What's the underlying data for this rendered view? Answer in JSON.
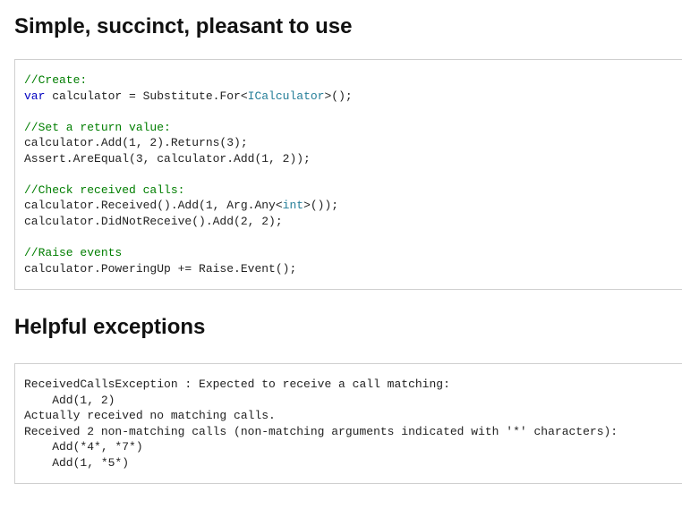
{
  "section1": {
    "heading": "Simple, succinct, pleasant to use",
    "code": {
      "c1": "//Create:",
      "kw_var": "var",
      "l2_a": " calculator = Substitute.For<",
      "l2_type": "ICalculator",
      "l2_b": ">();",
      "c2": "//Set a return value:",
      "l3": "calculator.Add(1, 2).Returns(3);",
      "l4": "Assert.AreEqual(3, calculator.Add(1, 2));",
      "c3": "//Check received calls:",
      "l5_a": "calculator.Received().Add(1, Arg.Any<",
      "l5_type": "int",
      "l5_b": ">());",
      "l6": "calculator.DidNotReceive().Add(2, 2);",
      "c4": "//Raise events",
      "l7": "calculator.PoweringUp += Raise.Event();"
    }
  },
  "section2": {
    "heading": "Helpful exceptions",
    "text": "ReceivedCallsException : Expected to receive a call matching:\n    Add(1, 2)\nActually received no matching calls.\nReceived 2 non-matching calls (non-matching arguments indicated with '*' characters):\n    Add(*4*, *7*)\n    Add(1, *5*)"
  }
}
